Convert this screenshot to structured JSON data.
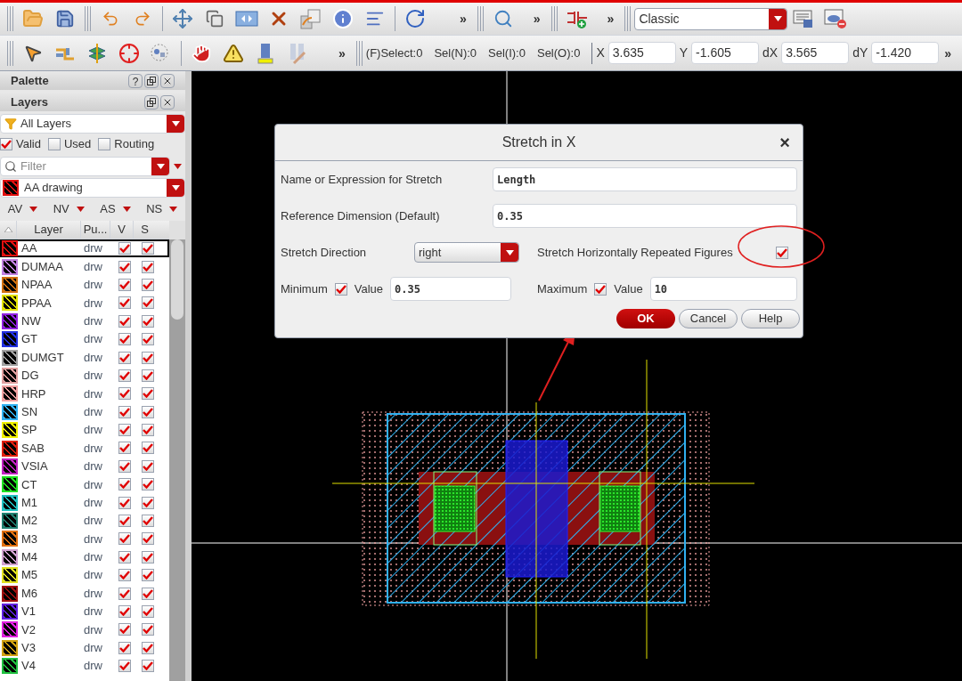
{
  "toolbar_top": {
    "overflow": [
      "»",
      "»",
      "»"
    ],
    "workspace": "Classic"
  },
  "toolbar_bottom": {
    "overflow": "»",
    "status": [
      "(F)Select:0",
      "Sel(N):0",
      "Sel(I):0",
      "Sel(O):0"
    ],
    "coords": [
      {
        "label": "X",
        "value": "3.635"
      },
      {
        "label": "Y",
        "value": "-1.605"
      },
      {
        "label": "dX",
        "value": "3.565"
      },
      {
        "label": "dY",
        "value": "-1.420"
      }
    ],
    "overflow_end": "»"
  },
  "palette": {
    "title": "Palette",
    "help": "?",
    "layers_title": "Layers",
    "filter_set": "All Layers",
    "checks": [
      {
        "label": "Valid",
        "checked": true
      },
      {
        "label": "Used",
        "checked": false
      },
      {
        "label": "Routing",
        "checked": false
      }
    ],
    "filter_placeholder": "Filter",
    "current_layer": {
      "name": "AA drawing",
      "color": "#e01010"
    },
    "column_menus": [
      "AV",
      "NV",
      "AS",
      "NS"
    ],
    "table": {
      "columns": [
        "Layer",
        "Pu...",
        "V",
        "S"
      ],
      "rows": [
        {
          "name": "AA",
          "purpose": "drw",
          "visible": true,
          "selectable": true,
          "selected": true,
          "color": "#e01010"
        },
        {
          "name": "DUMAA",
          "purpose": "drw",
          "visible": true,
          "selectable": true,
          "selected": false,
          "color": "#c080e0"
        },
        {
          "name": "NPAA",
          "purpose": "drw",
          "visible": true,
          "selectable": true,
          "selected": false,
          "color": "#d07010"
        },
        {
          "name": "PPAA",
          "purpose": "drw",
          "visible": true,
          "selectable": true,
          "selected": false,
          "color": "#e0e000"
        },
        {
          "name": "NW",
          "purpose": "drw",
          "visible": true,
          "selectable": true,
          "selected": false,
          "color": "#9020e0"
        },
        {
          "name": "GT",
          "purpose": "drw",
          "visible": true,
          "selectable": true,
          "selected": false,
          "color": "#2030e0"
        },
        {
          "name": "DUMGT",
          "purpose": "drw",
          "visible": true,
          "selectable": true,
          "selected": false,
          "color": "#a0a0a0"
        },
        {
          "name": "DG",
          "purpose": "drw",
          "visible": true,
          "selectable": true,
          "selected": false,
          "color": "#e0a0a0"
        },
        {
          "name": "HRP",
          "purpose": "drw",
          "visible": true,
          "selectable": true,
          "selected": false,
          "color": "#f0a0a0"
        },
        {
          "name": "SN",
          "purpose": "drw",
          "visible": true,
          "selectable": true,
          "selected": false,
          "color": "#30b0f0"
        },
        {
          "name": "SP",
          "purpose": "drw",
          "visible": true,
          "selectable": true,
          "selected": false,
          "color": "#f0f000"
        },
        {
          "name": "SAB",
          "purpose": "drw",
          "visible": true,
          "selectable": true,
          "selected": false,
          "color": "#e02010"
        },
        {
          "name": "VSIA",
          "purpose": "drw",
          "visible": true,
          "selectable": true,
          "selected": false,
          "color": "#c020c0"
        },
        {
          "name": "CT",
          "purpose": "drw",
          "visible": true,
          "selectable": true,
          "selected": false,
          "color": "#20e020"
        },
        {
          "name": "M1",
          "purpose": "drw",
          "visible": true,
          "selectable": true,
          "selected": false,
          "color": "#20c0c0"
        },
        {
          "name": "M2",
          "purpose": "drw",
          "visible": true,
          "selectable": true,
          "selected": false,
          "color": "#208070"
        },
        {
          "name": "M3",
          "purpose": "drw",
          "visible": true,
          "selectable": true,
          "selected": false,
          "color": "#e07010"
        },
        {
          "name": "M4",
          "purpose": "drw",
          "visible": true,
          "selectable": true,
          "selected": false,
          "color": "#d0a0d0"
        },
        {
          "name": "M5",
          "purpose": "drw",
          "visible": true,
          "selectable": true,
          "selected": false,
          "color": "#e0e020"
        },
        {
          "name": "M6",
          "purpose": "drw",
          "visible": true,
          "selectable": true,
          "selected": false,
          "color": "#a01010"
        },
        {
          "name": "V1",
          "purpose": "drw",
          "visible": true,
          "selectable": true,
          "selected": false,
          "color": "#6020e0"
        },
        {
          "name": "V2",
          "purpose": "drw",
          "visible": true,
          "selectable": true,
          "selected": false,
          "color": "#e020e0"
        },
        {
          "name": "V3",
          "purpose": "drw",
          "visible": true,
          "selectable": true,
          "selected": false,
          "color": "#d0a010"
        },
        {
          "name": "V4",
          "purpose": "drw",
          "visible": true,
          "selectable": true,
          "selected": false,
          "color": "#20c040"
        }
      ]
    }
  },
  "dialog": {
    "title": "Stretch in X",
    "close": "×",
    "name_label": "Name or Expression for Stretch",
    "name_value": "Length",
    "ref_label": "Reference Dimension (Default)",
    "ref_value": "0.35",
    "direction_label": "Stretch Direction",
    "direction_value": "right",
    "repeat_label": "Stretch Horizontally Repeated Figures",
    "repeat_checked": true,
    "minimum": {
      "label": "Minimum",
      "checked": true,
      "value_label": "Value",
      "value": "0.35"
    },
    "maximum": {
      "label": "Maximum",
      "checked": true,
      "value_label": "Value",
      "value": "10"
    },
    "buttons": [
      {
        "label": "OK",
        "kind": "primary"
      },
      {
        "label": "Cancel",
        "kind": "normal"
      },
      {
        "label": "Help",
        "kind": "normal"
      }
    ]
  }
}
